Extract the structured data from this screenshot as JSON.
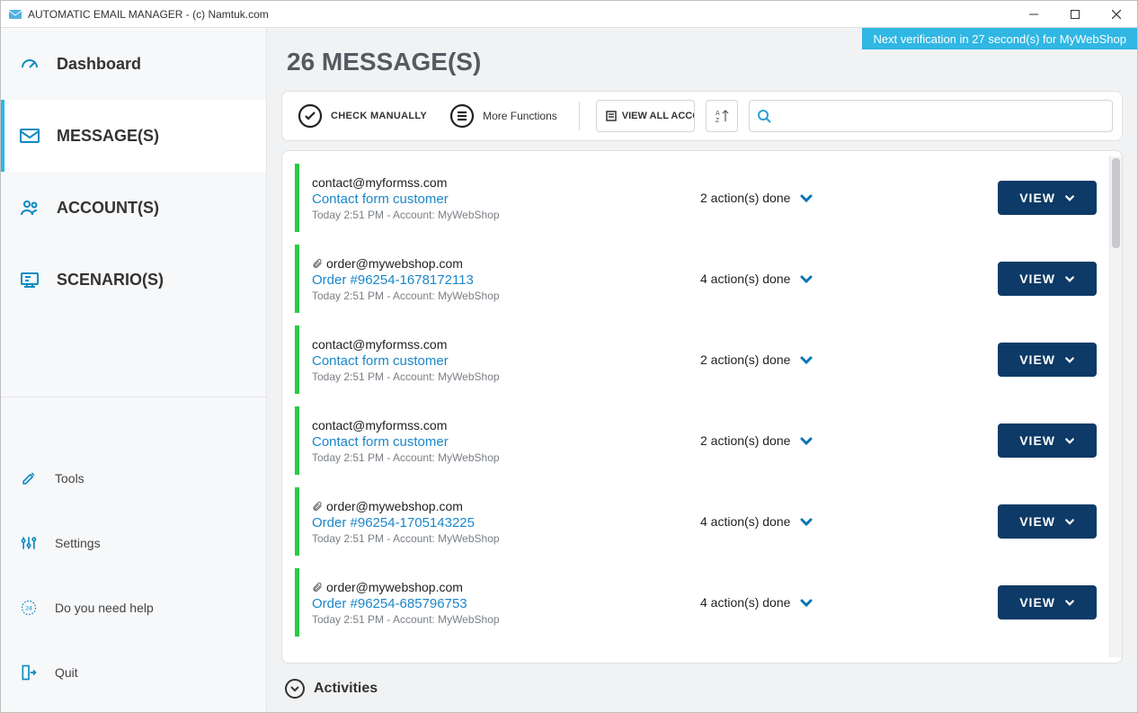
{
  "window": {
    "title": "AUTOMATIC EMAIL MANAGER - (c) Namtuk.com"
  },
  "sidebar": {
    "top": [
      {
        "label": "Dashboard",
        "icon": "gauge"
      },
      {
        "label": "MESSAGE(S)",
        "icon": "envelope"
      },
      {
        "label": "ACCOUNT(S)",
        "icon": "users"
      },
      {
        "label": "SCENARIO(S)",
        "icon": "scenario"
      }
    ],
    "bottom": [
      {
        "label": "Tools",
        "icon": "tools"
      },
      {
        "label": "Settings",
        "icon": "sliders"
      },
      {
        "label": "Do you need help",
        "icon": "help"
      },
      {
        "label": "Quit",
        "icon": "quit"
      }
    ]
  },
  "banner": "Next verification in 27 second(s) for MyWebShop",
  "page_title": "26 MESSAGE(S)",
  "toolbar": {
    "check_label": "CHECK MANUALLY",
    "more_label": "More Functions",
    "view_all_label": "VIEW ALL ACCO",
    "search_placeholder": ""
  },
  "messages": [
    {
      "from": "contact@myformss.com",
      "attachment": false,
      "subject": "Contact form customer",
      "meta": "Today 2:51 PM - Account: MyWebShop",
      "actions": "2 action(s) done",
      "view": "VIEW"
    },
    {
      "from": "order@mywebshop.com",
      "attachment": true,
      "subject": "Order #96254-1678172113",
      "meta": "Today 2:51 PM - Account: MyWebShop",
      "actions": "4 action(s) done",
      "view": "VIEW"
    },
    {
      "from": "contact@myformss.com",
      "attachment": false,
      "subject": "Contact form customer",
      "meta": "Today 2:51 PM - Account: MyWebShop",
      "actions": "2 action(s) done",
      "view": "VIEW"
    },
    {
      "from": "contact@myformss.com",
      "attachment": false,
      "subject": "Contact form customer",
      "meta": "Today 2:51 PM - Account: MyWebShop",
      "actions": "2 action(s) done",
      "view": "VIEW"
    },
    {
      "from": "order@mywebshop.com",
      "attachment": true,
      "subject": "Order #96254-1705143225",
      "meta": "Today 2:51 PM - Account: MyWebShop",
      "actions": "4 action(s) done",
      "view": "VIEW"
    },
    {
      "from": "order@mywebshop.com",
      "attachment": true,
      "subject": "Order #96254-685796753",
      "meta": "Today 2:51 PM - Account: MyWebShop",
      "actions": "4 action(s) done",
      "view": "VIEW"
    }
  ],
  "activities_label": "Activities"
}
